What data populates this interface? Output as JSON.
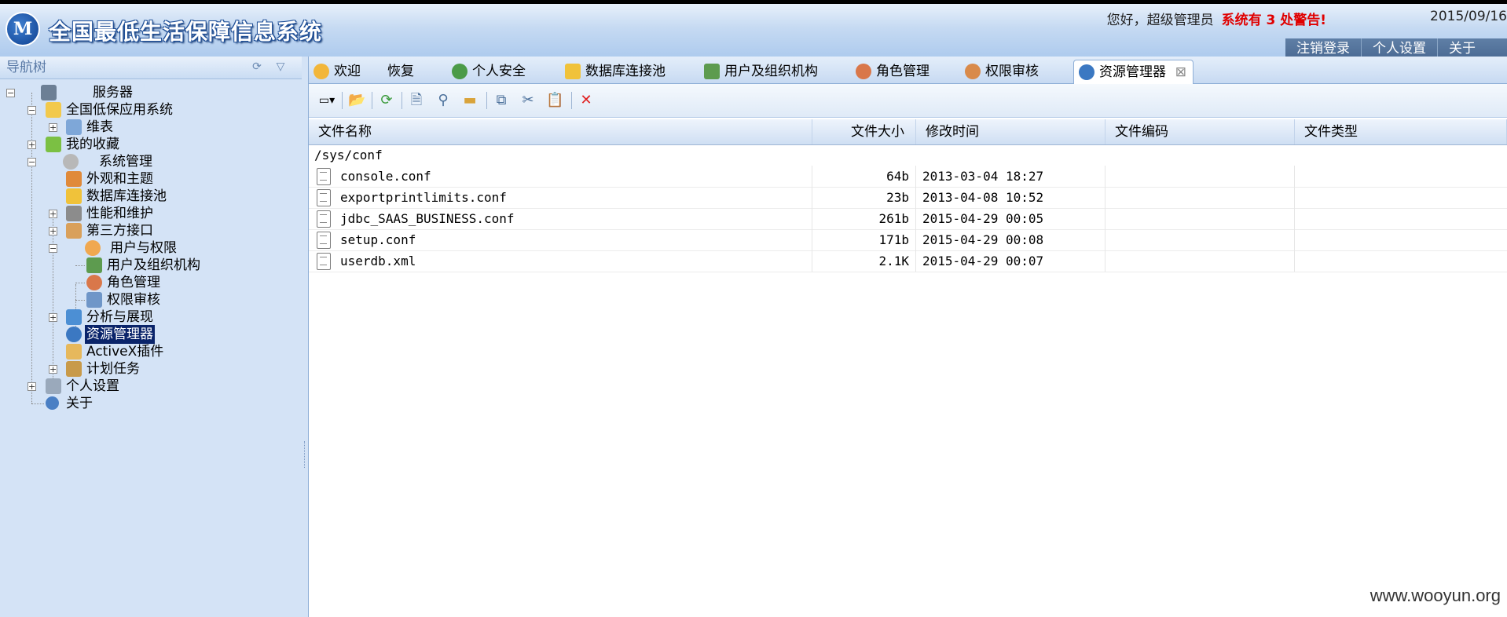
{
  "header": {
    "logo_text": "M",
    "app_title": "全国最低生活保障信息系统",
    "greeting": "您好，超级管理员",
    "warning": "系统有 3 处警告!",
    "date": "2015/09/16",
    "menu": [
      "注销登录",
      "个人设置",
      "关于"
    ]
  },
  "nav": {
    "title": "导航树",
    "items": [
      {
        "label": "服务器"
      },
      {
        "label": "全国低保应用系统"
      },
      {
        "label": "维表"
      },
      {
        "label": "我的收藏"
      },
      {
        "label": "系统管理"
      },
      {
        "label": "外观和主题"
      },
      {
        "label": "数据库连接池"
      },
      {
        "label": "性能和维护"
      },
      {
        "label": "第三方接口"
      },
      {
        "label": "用户与权限"
      },
      {
        "label": "用户及组织机构"
      },
      {
        "label": "角色管理"
      },
      {
        "label": "权限审核"
      },
      {
        "label": "分析与展现"
      },
      {
        "label": "资源管理器"
      },
      {
        "label": "ActiveX插件"
      },
      {
        "label": "计划任务"
      },
      {
        "label": "个人设置"
      },
      {
        "label": "关于"
      }
    ]
  },
  "tabs": [
    {
      "label": "欢迎"
    },
    {
      "label": "恢复"
    },
    {
      "label": "个人安全"
    },
    {
      "label": "数据库连接池"
    },
    {
      "label": "用户及组织机构"
    },
    {
      "label": "角色管理"
    },
    {
      "label": "权限审核"
    },
    {
      "label": "资源管理器"
    }
  ],
  "grid": {
    "columns": [
      "文件名称",
      "文件大小",
      "修改时间",
      "文件编码",
      "文件类型"
    ],
    "path": "/sys/conf",
    "rows": [
      {
        "name": "console.conf",
        "size": "64b",
        "modified": "2013-03-04   18:27"
      },
      {
        "name": "exportprintlimits.conf",
        "size": "23b",
        "modified": "2013-04-08   10:52"
      },
      {
        "name": "jdbc_SAAS_BUSINESS.conf",
        "size": "261b",
        "modified": "2015-04-29   00:05"
      },
      {
        "name": "setup.conf",
        "size": "171b",
        "modified": "2015-04-29   00:08"
      },
      {
        "name": "userdb.xml",
        "size": "2.1K",
        "modified": "2015-04-29   00:07"
      }
    ]
  },
  "watermark": "www.wooyun.org"
}
